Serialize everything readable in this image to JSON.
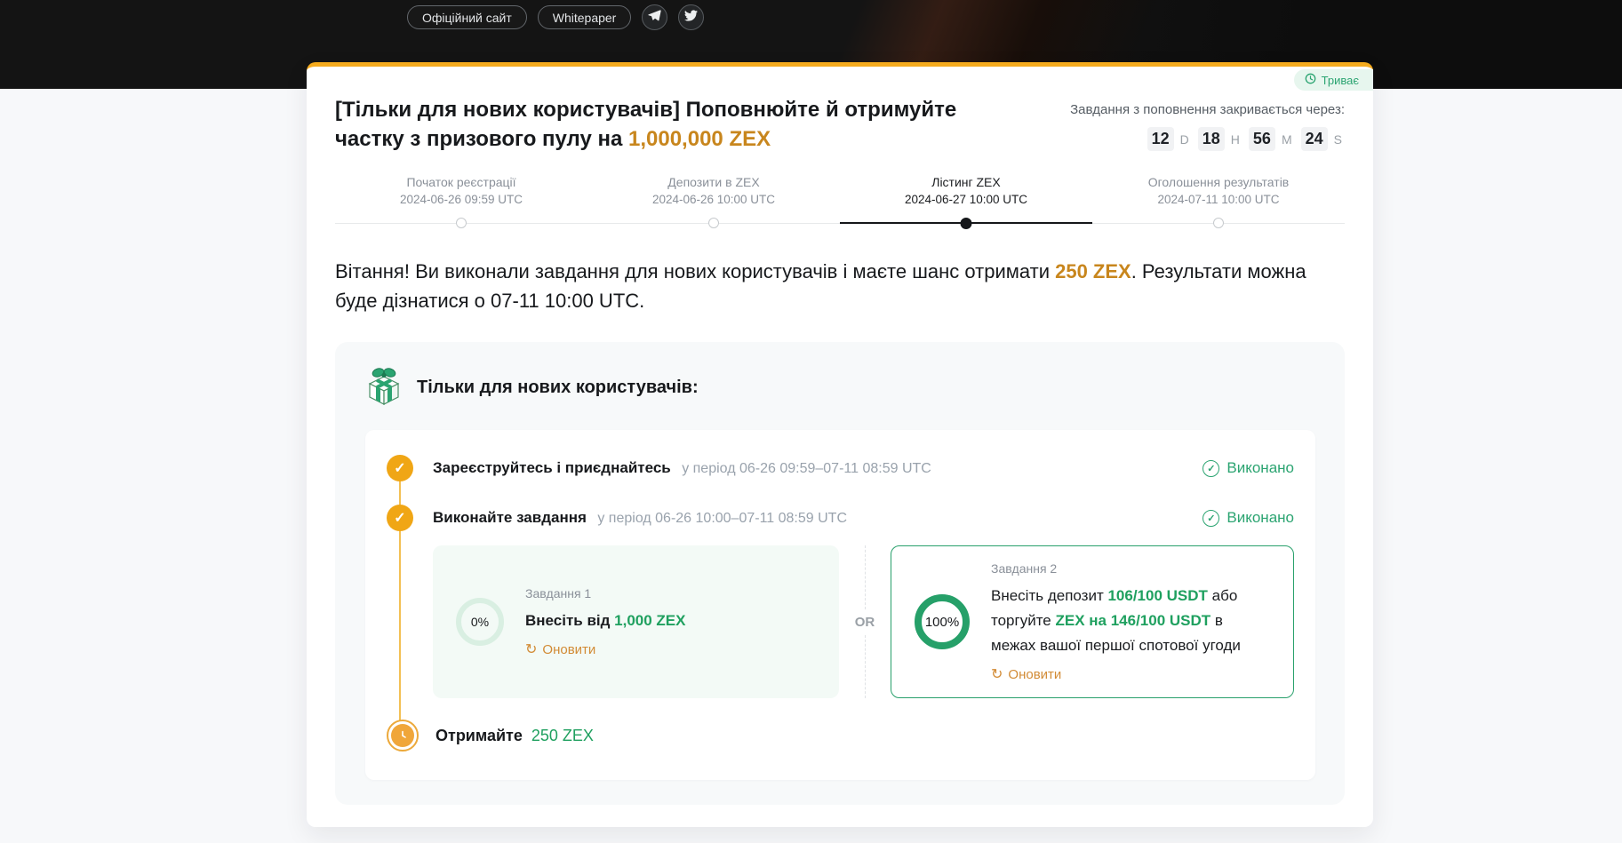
{
  "topbar": {
    "official_site_label": "Офіційний сайт",
    "whitepaper_label": "Whitepaper"
  },
  "card": {
    "status_badge": "Триває",
    "title": {
      "prefix": "[Тільки для нових користувачів] Поповнюйте й отримуйте частку з призового пулу на ",
      "highlight": "1,000,000 ZEX"
    },
    "countdown": {
      "label": "Завдання з поповнення закривається через:",
      "units": [
        {
          "value": "12",
          "unit": "D"
        },
        {
          "value": "18",
          "unit": "H"
        },
        {
          "value": "56",
          "unit": "M"
        },
        {
          "value": "24",
          "unit": "S"
        }
      ]
    },
    "timeline": [
      {
        "label": "Початок реєстрації",
        "date": "2024-06-26 09:59 UTC",
        "active": false
      },
      {
        "label": "Депозити в ZEX",
        "date": "2024-06-26 10:00 UTC",
        "active": false
      },
      {
        "label": "Лістинг ZEX",
        "date": "2024-06-27 10:00 UTC",
        "active": true
      },
      {
        "label": "Оголошення результатів",
        "date": "2024-07-11 10:00 UTC",
        "active": false
      }
    ],
    "congrats": {
      "pre": "Вітання! Ви виконали завдання для нових користувачів і маєте шанс отримати ",
      "highlight": "250 ZEX",
      "post": ". Результати можна буде дізнатися о 07-11 10:00 UTC."
    }
  },
  "tasks": {
    "section_title": "Тільки для нових користувачів:",
    "check_glyph": "✓",
    "rows": [
      {
        "title": "Зареєструйтесь і приєднайтесь",
        "period": "у період 06-26 09:59–07-11 08:59 UTC",
        "status": "Виконано"
      },
      {
        "title": "Виконайте завдання",
        "period": "у період 06-26 10:00–07-11 08:59 UTC",
        "status": "Виконано"
      }
    ],
    "or_label": "OR",
    "task1": {
      "label": "Завдання 1",
      "progress": "0%",
      "text_pre": "Внесіть від ",
      "text_highlight": "1,000 ZEX",
      "refresh_label": "Оновити",
      "refresh_glyph": "↻"
    },
    "task2": {
      "label": "Завдання 2",
      "progress": "100%",
      "parts": [
        "Внесіть депозит ",
        "106/100 USDT",
        " або торгуйте ",
        "ZEX на 146/100 USDT",
        " в межах вашої першої спотової угоди"
      ],
      "refresh_label": "Оновити",
      "refresh_glyph": "↻"
    },
    "final": {
      "title": "Отримайте",
      "highlight": "250 ZEX"
    }
  },
  "colors": {
    "card_top_border": "#f5ab1e",
    "highlight_gold": "#c8861d",
    "green_text": "#1fa05f",
    "status_green": "#2ba471",
    "check_orange": "#f0a615",
    "refresh_orange": "#d28b35"
  }
}
